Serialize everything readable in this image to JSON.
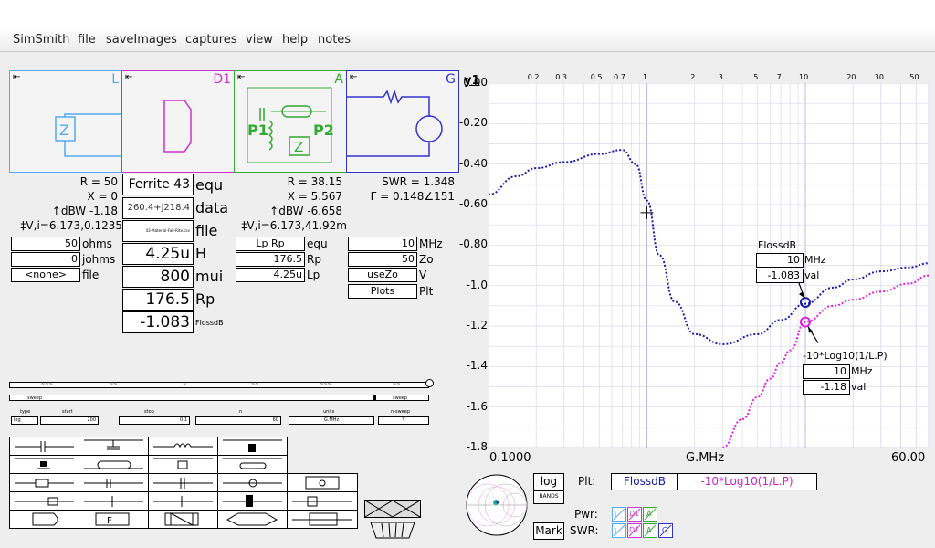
{
  "menu": [
    "SimSmith",
    "file",
    "saveImages",
    "captures",
    "view",
    "help",
    "notes"
  ],
  "blocks": {
    "L": {
      "name": "L",
      "color": "#3399ff"
    },
    "D1": {
      "name": "D1",
      "color": "#cc33cc"
    },
    "A": {
      "name": "A",
      "color": "#33aa33"
    },
    "G": {
      "name": "G",
      "color": "#3333ff"
    }
  },
  "block_A_ports": {
    "p1": "P1",
    "p2": "P2"
  },
  "load": {
    "r": "R = 50",
    "x": "X = 0",
    "dbw": "↑dBW -1.18",
    "vi": "‡V,i=6.173,0.1235",
    "fields": [
      {
        "value": "50",
        "unit": "ohms"
      },
      {
        "value": "0",
        "unit": "johms"
      },
      {
        "value": "<none>",
        "unit": "file"
      }
    ]
  },
  "ferrite": {
    "title": "Ferrite 43",
    "title_unit": "equ",
    "data_val": "260.4+j218.4",
    "data_unit": "data",
    "file_val": "43-Material-Fair-Rite.csv",
    "file_unit": "file",
    "h_val": "4.25u",
    "h_unit": "H",
    "mui_val": "800",
    "mui_unit": "mui",
    "rp_val": "176.5",
    "rp_unit": "Rp",
    "loss_val": "-1.083",
    "loss_unit": "FlossdB"
  },
  "equ": {
    "r": "R = 38.15",
    "x": "X = 5.567",
    "dbw": "↑dBW -6.658",
    "vi": "‡V,i=6.173,41.92m",
    "fields": [
      {
        "value": "Lp Rp",
        "unit": "equ"
      },
      {
        "value": "176.5",
        "unit": "Rp"
      },
      {
        "value": "4.25u",
        "unit": "Lp"
      }
    ]
  },
  "gen": {
    "swr": "SWR = 1.348",
    "gamma": "Γ = 0.148∠151",
    "fields": [
      {
        "value": "10",
        "unit": "MHz"
      },
      {
        "value": "50",
        "unit": "Zo"
      },
      {
        "value": "useZo",
        "unit": "V"
      },
      {
        "value": "Plots",
        "unit": "Plt"
      }
    ]
  },
  "sweep": {
    "row1": [
      "~~~",
      "~~",
      "~",
      "~~",
      "~~~",
      "~~"
    ],
    "row2_left": "sweep",
    "row2_right": "sweep",
    "labels": [
      "type",
      "start",
      "stop",
      "n",
      "units",
      "n-sweep"
    ],
    "values": [
      "log",
      "200",
      "0.1",
      "60",
      "G.MHz",
      "Y"
    ]
  },
  "chart_data": {
    "type": "line",
    "ylabel": "y1",
    "xlabel": "G.MHz",
    "x_scale": "log",
    "xlim": [
      0.1,
      60.0
    ],
    "ylim": [
      -1.8,
      0.0
    ],
    "x_tick_labels_bottom": [
      "0.1000",
      "G.MHz",
      "60.00"
    ],
    "x_tick_labels_top": [
      "0.2",
      "0.3",
      "0.5",
      "0.7",
      "1",
      "2",
      "3",
      "5",
      "7",
      "10",
      "20",
      "30",
      "50"
    ],
    "y_tick_labels": [
      "0.00",
      "-0.20",
      "-0.40",
      "-0.60",
      "-0.80",
      "-1.0",
      "-1.2",
      "-1.4",
      "-1.6",
      "-1.8"
    ],
    "grid": true,
    "series": [
      {
        "name": "FlossdB",
        "color": "#1a1aa8",
        "x": [
          0.1,
          0.15,
          0.2,
          0.3,
          0.5,
          0.7,
          0.85,
          1.0,
          1.2,
          1.5,
          2.0,
          3.0,
          5.0,
          7.0,
          10.0,
          15.0,
          20.0,
          30.0,
          45.0,
          60.0
        ],
        "y": [
          -0.55,
          -0.46,
          -0.42,
          -0.39,
          -0.35,
          -0.33,
          -0.4,
          -0.58,
          -0.85,
          -1.08,
          -1.24,
          -1.29,
          -1.24,
          -1.17,
          -1.09,
          -1.01,
          -0.97,
          -0.93,
          -0.91,
          -0.89
        ]
      },
      {
        "name": "-10*Log10(1/L.P)",
        "color": "#e020e0",
        "x": [
          3.0,
          4.0,
          5.0,
          6.0,
          7.0,
          8.0,
          10.0,
          15.0,
          20.0,
          30.0,
          45.0,
          60.0
        ],
        "y": [
          -1.8,
          -1.66,
          -1.55,
          -1.46,
          -1.38,
          -1.32,
          -1.18,
          -1.1,
          -1.07,
          -1.03,
          -0.99,
          -0.95
        ]
      }
    ],
    "markers": [
      {
        "series": "FlossdB",
        "box_title": "FlossdB",
        "freq": "10",
        "freq_unit": "MHz",
        "val": "-1.083",
        "val_unit": "val"
      },
      {
        "series": "-10*Log10(1/L.P)",
        "box_title": "-10*Log10(1/L.P)",
        "freq": "10",
        "freq_unit": "MHz",
        "val": "-1.18",
        "val_unit": "val"
      }
    ]
  },
  "bottom": {
    "log_btn": "log",
    "bands_btn": "BANDS",
    "mark_btn": "Mark",
    "plt_label": "Plt:",
    "plt1": "FlossdB",
    "plt2": "-10*Log10(1/L.P)",
    "pwr_label": "Pwr:",
    "swr_label": "SWR:",
    "mini_labels": [
      "L",
      "D1",
      "A",
      "G"
    ]
  }
}
